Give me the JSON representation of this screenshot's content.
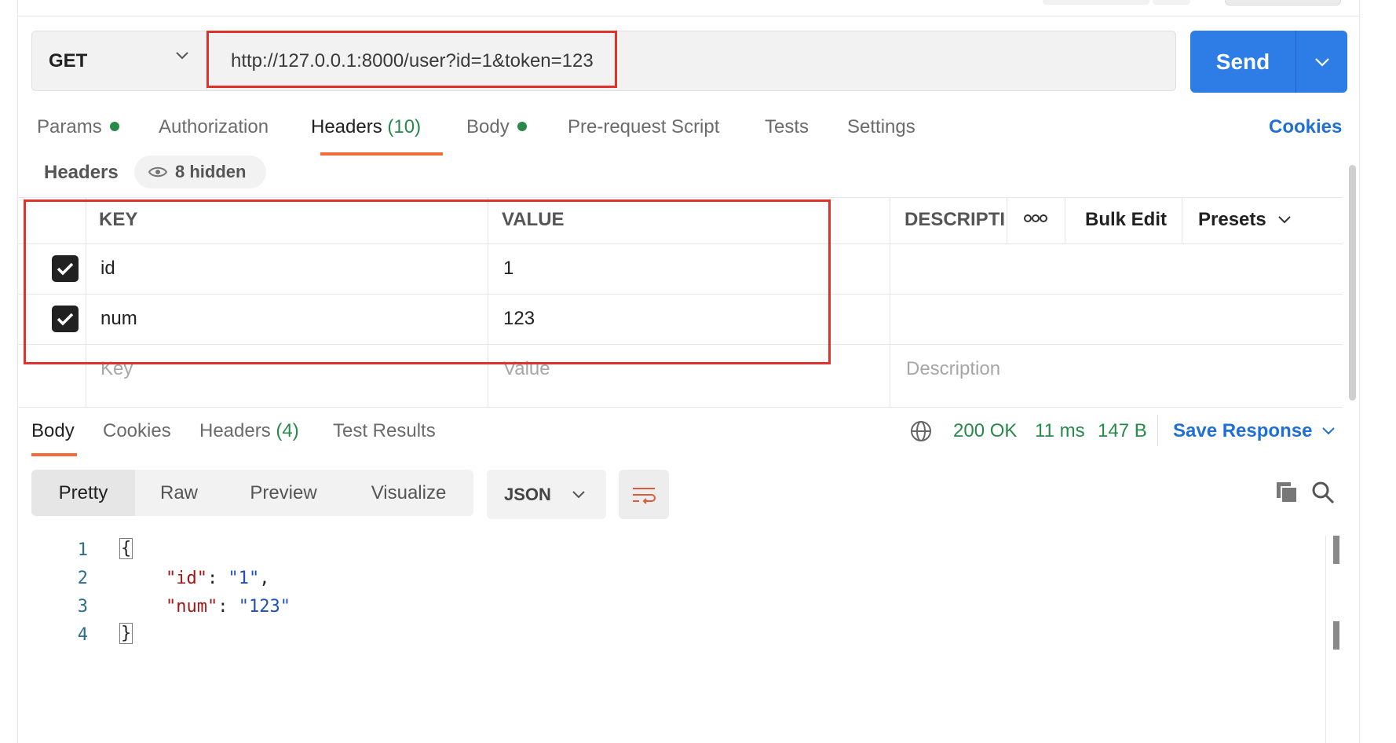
{
  "request": {
    "method": "GET",
    "url": "http://127.0.0.1:8000/user?id=1&token=123",
    "send_label": "Send"
  },
  "request_tabs": [
    {
      "label": "Params",
      "dot": true
    },
    {
      "label": "Authorization"
    },
    {
      "label": "Headers",
      "count": "(10)",
      "active": true
    },
    {
      "label": "Body",
      "dot": true
    },
    {
      "label": "Pre-request Script"
    },
    {
      "label": "Tests"
    },
    {
      "label": "Settings"
    }
  ],
  "cookies_link": "Cookies",
  "headers_section": {
    "title": "Headers",
    "hidden_label": "8 hidden",
    "columns": {
      "key": "KEY",
      "value": "VALUE",
      "description": "DESCRIPTIC"
    },
    "more_icon": "ooo",
    "bulk_edit": "Bulk Edit",
    "presets": "Presets",
    "rows": [
      {
        "checked": true,
        "key": "id",
        "value": "1"
      },
      {
        "checked": true,
        "key": "num",
        "value": "123"
      }
    ],
    "placeholders": {
      "key": "Key",
      "value": "Value",
      "description": "Description"
    }
  },
  "response_tabs": [
    {
      "label": "Body",
      "active": true
    },
    {
      "label": "Cookies"
    },
    {
      "label": "Headers",
      "count": "(4)"
    },
    {
      "label": "Test Results"
    }
  ],
  "response_status": {
    "status": "200 OK",
    "time": "11 ms",
    "size": "147 B"
  },
  "save_response": "Save Response",
  "view_modes": [
    "Pretty",
    "Raw",
    "Preview",
    "Visualize"
  ],
  "format": "JSON",
  "code": {
    "line_numbers": [
      "1",
      "2",
      "3",
      "4"
    ],
    "open_brace": "{",
    "close_brace": "}",
    "lines": [
      {
        "key": "\"id\"",
        "sep": ": ",
        "value": "\"1\"",
        "tail": ","
      },
      {
        "key": "\"num\"",
        "sep": ": ",
        "value": "\"123\"",
        "tail": ""
      }
    ]
  },
  "colors": {
    "accent": "#2e7ce6",
    "tab_underline": "#f26b3a",
    "status_green": "#27894a",
    "highlight_red": "#e0312b"
  }
}
